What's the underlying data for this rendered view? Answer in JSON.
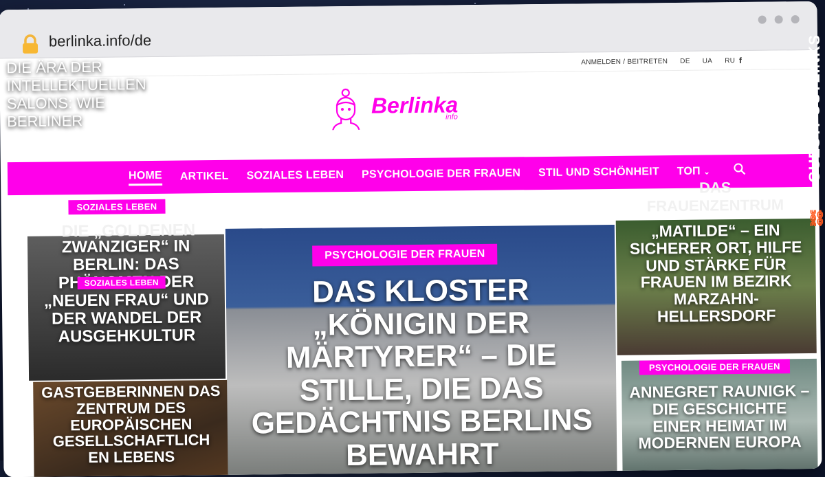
{
  "browser": {
    "url": "berlinka.info/de"
  },
  "topbar": {
    "login": "ANMELDEN / BEITRETEN",
    "langs": [
      "DE",
      "UA",
      "RU"
    ],
    "facebook_glyph": "f"
  },
  "logo": {
    "name": "Berlinka",
    "sub": "info"
  },
  "nav": {
    "items": [
      "HOME",
      "ARTIKEL",
      "SOZIALES LEBEN",
      "PSYCHOLOGIE DER FRAUEN",
      "STIL UND SCHÖNHEIT",
      "ТОП"
    ],
    "active": "HOME",
    "search_icon": "search-icon"
  },
  "tiles": {
    "top_left": {
      "tag": "SOZIALES LEBEN",
      "ghost_title": "DIE „GOLDENEN",
      "title": "ZWANZIGER“ IN BERLIN: DAS PHÄNOMEN DER „NEUEN FRAU“ UND DER WANDEL DER AUSGEHKULTUR"
    },
    "mid_left": {
      "tag": "SOZIALES LEBEN",
      "title": "DIE ÄRA DER INTELLEKTUELLEN SALONS: WIE BERLINER"
    },
    "bottom_left": {
      "title": "GASTGEBERINNEN DAS ZENTRUM DES EUROPÄISCHEN GESELLSCHAFTLICH EN LEBENS"
    },
    "center": {
      "tag": "PSYCHOLOGIE DER FRAUEN",
      "title": "DAS KLOSTER „KÖNIGIN DER MÄRTYRER“ – DIE STILLE, DIE DAS GEDÄCHTNIS BERLINS BEWAHRT"
    },
    "top_right": {
      "ghost_title": "DAS FRAUENZENTRUM",
      "title": "„MATILDE“ – EIN SICHERER ORT, HILFE UND STÄRKE FÜR FRAUEN IM BEZIRK MARZAHN-HELLERSDORF"
    },
    "bottom_right": {
      "tag": "PSYCHOLOGIE DER FRAUEN",
      "title": "ANNEGRET RAUNIGK – DIE GESCHICHTE EINER HEIMAT IM MODERNEN EUROPA"
    }
  },
  "side_brand": {
    "text": "GUESTPOSTLINKS"
  },
  "colors": {
    "accent": "#ff00ea",
    "chrome": "#e9e9ec"
  }
}
